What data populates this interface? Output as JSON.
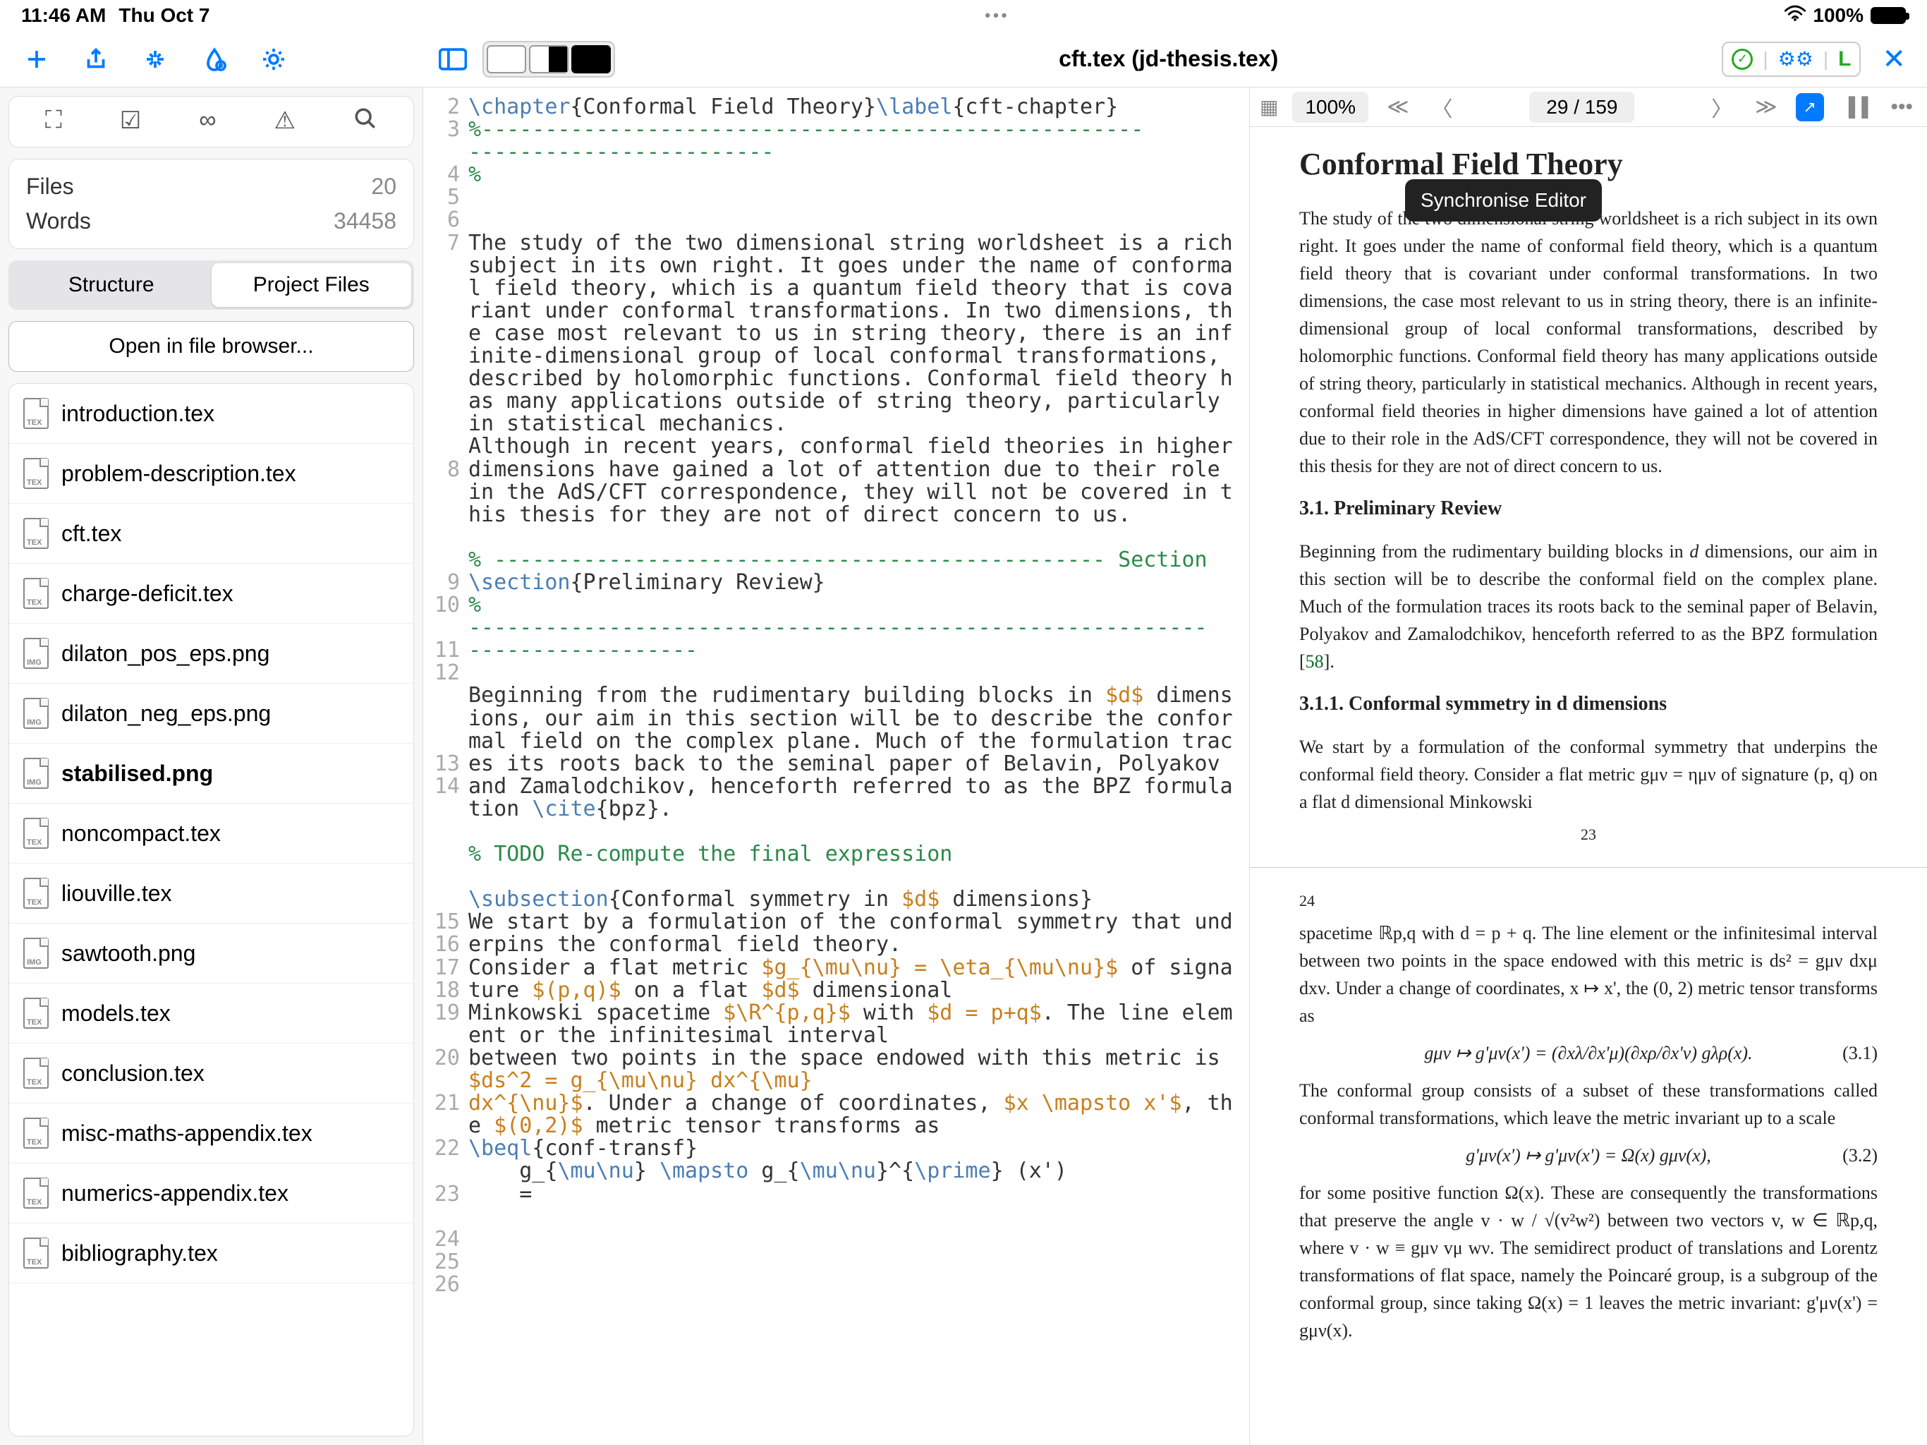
{
  "status_bar": {
    "time": "11:46 AM",
    "date": "Thu Oct 7",
    "wifi": "wifi-icon",
    "battery_pct": "100%"
  },
  "toolbar": {
    "title": "cft.tex (jd-thesis.tex)",
    "status_letter": "L"
  },
  "sidebar": {
    "stats": {
      "files_label": "Files",
      "files_value": "20",
      "words_label": "Words",
      "words_value": "34458"
    },
    "segments": {
      "structure": "Structure",
      "project": "Project Files"
    },
    "open_browser": "Open in file browser...",
    "files": [
      {
        "name": "introduction.tex",
        "ext": "TEX",
        "icon": "tex",
        "bold": false
      },
      {
        "name": "problem-description.tex",
        "ext": "TEX",
        "icon": "tex",
        "bold": false
      },
      {
        "name": "cft.tex",
        "ext": "TEX",
        "icon": "tex",
        "bold": false
      },
      {
        "name": "charge-deficit.tex",
        "ext": "TEX",
        "icon": "tex",
        "bold": false
      },
      {
        "name": "dilaton_pos_eps.png",
        "ext": "IMG",
        "icon": "img",
        "bold": false
      },
      {
        "name": "dilaton_neg_eps.png",
        "ext": "IMG",
        "icon": "img",
        "bold": false
      },
      {
        "name": "stabilised.png",
        "ext": "IMG",
        "icon": "img",
        "bold": true
      },
      {
        "name": "noncompact.tex",
        "ext": "TEX",
        "icon": "tex",
        "bold": false
      },
      {
        "name": "liouville.tex",
        "ext": "TEX",
        "icon": "tex",
        "bold": false
      },
      {
        "name": "sawtooth.png",
        "ext": "IMG",
        "icon": "img",
        "bold": false
      },
      {
        "name": "models.tex",
        "ext": "TEX",
        "icon": "tex",
        "bold": false
      },
      {
        "name": "conclusion.tex",
        "ext": "TEX",
        "icon": "tex",
        "bold": false
      },
      {
        "name": "misc-maths-appendix.tex",
        "ext": "TEX",
        "icon": "tex",
        "bold": false
      },
      {
        "name": "numerics-appendix.tex",
        "ext": "TEX",
        "icon": "tex",
        "bold": false
      },
      {
        "name": "bibliography.tex",
        "ext": "TEX",
        "icon": "tex",
        "bold": false
      }
    ]
  },
  "editor": {
    "lines": [
      {
        "n": 2,
        "segs": [
          {
            "t": "\\chapter",
            "c": "kw"
          },
          {
            "t": "{Conformal Field Theory}"
          },
          {
            "t": "\\label",
            "c": "kw"
          },
          {
            "t": "{cft-chapter}"
          }
        ]
      },
      {
        "n": 3,
        "segs": [
          {
            "t": "%----------------------------------------------------",
            "c": "cm"
          }
        ]
      },
      {
        "n": "",
        "segs": [
          {
            "t": "------------------------",
            "c": "cm"
          }
        ]
      },
      {
        "n": 4,
        "segs": [
          {
            "t": "%",
            "c": "cm"
          }
        ]
      },
      {
        "n": 5,
        "segs": [
          {
            "t": ""
          }
        ]
      },
      {
        "n": 6,
        "segs": [
          {
            "t": ""
          }
        ]
      },
      {
        "n": 7,
        "segs": [
          {
            "t": "The study of the two dimensional string worldsheet is a rich subject in its own right. It goes under the name of conformal field theory, which is a quantum field theory that is covariant under conformal transformations. In two dimensions, the case most relevant to us in string theory, there is an infinite-dimensional group of local conformal transformations, described by holomorphic functions. Conformal field theory has many applications outside of string theory, particularly in statistical mechanics."
          }
        ]
      },
      {
        "n": 8,
        "segs": [
          {
            "t": "Although in recent years, conformal field theories in higher dimensions have gained a lot of attention due to their role in the AdS/CFT correspondence, they will not be covered in this thesis for they are not of direct concern to us."
          }
        ]
      },
      {
        "n": 9,
        "segs": [
          {
            "t": ""
          }
        ]
      },
      {
        "n": 10,
        "segs": [
          {
            "t": "% ------------------------------------------------ Section",
            "c": "cm"
          }
        ]
      },
      {
        "n": 11,
        "segs": [
          {
            "t": "\\section",
            "c": "kw"
          },
          {
            "t": "{Preliminary Review}"
          }
        ]
      },
      {
        "n": 12,
        "segs": [
          {
            "t": "%",
            "c": "cm"
          }
        ]
      },
      {
        "n": "",
        "segs": [
          {
            "t": "----------------------------------------------------------",
            "c": "cm"
          }
        ]
      },
      {
        "n": "",
        "segs": [
          {
            "t": "------------------",
            "c": "cm"
          }
        ]
      },
      {
        "n": 13,
        "segs": [
          {
            "t": ""
          }
        ]
      },
      {
        "n": 14,
        "segs": [
          {
            "t": "Beginning from the rudimentary building blocks in "
          },
          {
            "t": "$d$",
            "c": "math"
          },
          {
            "t": " dimensions, our aim in this section will be to describe the conformal field on the complex plane. Much of the formulation traces its roots back to the seminal paper of Belavin, Polyakov and Zamalodchikov, henceforth referred to as the BPZ formulation "
          },
          {
            "t": "\\cite",
            "c": "kw"
          },
          {
            "t": "{bpz}."
          }
        ]
      },
      {
        "n": 15,
        "segs": [
          {
            "t": ""
          }
        ]
      },
      {
        "n": 16,
        "segs": [
          {
            "t": "% TODO Re-compute the final expression",
            "c": "cm"
          }
        ]
      },
      {
        "n": 17,
        "segs": [
          {
            "t": ""
          }
        ]
      },
      {
        "n": 18,
        "segs": [
          {
            "t": "\\subsection",
            "c": "kw"
          },
          {
            "t": "{Conformal symmetry in "
          },
          {
            "t": "$d$",
            "c": "math"
          },
          {
            "t": " dimensions}"
          }
        ]
      },
      {
        "n": 19,
        "segs": [
          {
            "t": "We start by a formulation of the conformal symmetry that underpins the conformal field theory."
          }
        ]
      },
      {
        "n": 20,
        "segs": [
          {
            "t": "Consider a flat metric "
          },
          {
            "t": "$g_{\\mu\\nu} = \\eta_{\\mu\\nu}$",
            "c": "math"
          },
          {
            "t": " of signature "
          },
          {
            "t": "$(p,q)$",
            "c": "math"
          },
          {
            "t": " on a flat "
          },
          {
            "t": "$d$",
            "c": "math"
          },
          {
            "t": " dimensional"
          }
        ]
      },
      {
        "n": 21,
        "segs": [
          {
            "t": "Minkowski spacetime "
          },
          {
            "t": "$\\R^{p,q}$",
            "c": "math"
          },
          {
            "t": " with "
          },
          {
            "t": "$d = p+q$",
            "c": "math"
          },
          {
            "t": ". The line element or the infinitesimal interval"
          }
        ]
      },
      {
        "n": 22,
        "segs": [
          {
            "t": "between two points in the space endowed with this metric is "
          },
          {
            "t": "$ds^2 = g_{\\mu\\nu} dx^{\\mu}",
            "c": "math"
          }
        ]
      },
      {
        "n": 23,
        "segs": [
          {
            "t": "dx^{\\nu}$",
            "c": "math"
          },
          {
            "t": ". Under a change of coordinates, "
          },
          {
            "t": "$x \\mapsto x'$",
            "c": "math"
          },
          {
            "t": ", the "
          },
          {
            "t": "$(0,2)$",
            "c": "math"
          },
          {
            "t": " metric tensor transforms as"
          }
        ]
      },
      {
        "n": 24,
        "segs": [
          {
            "t": "\\beql",
            "c": "kw"
          },
          {
            "t": "{conf-transf}"
          }
        ]
      },
      {
        "n": 25,
        "segs": [
          {
            "t": "    g_{"
          },
          {
            "t": "\\mu\\nu",
            "c": "kw"
          },
          {
            "t": "} "
          },
          {
            "t": "\\mapsto",
            "c": "kw"
          },
          {
            "t": " g_{"
          },
          {
            "t": "\\mu\\nu",
            "c": "kw"
          },
          {
            "t": "}^{"
          },
          {
            "t": "\\prime",
            "c": "kw"
          },
          {
            "t": "} (x')"
          }
        ]
      },
      {
        "n": 26,
        "segs": [
          {
            "t": "    ="
          }
        ]
      }
    ]
  },
  "preview": {
    "zoom": "100%",
    "page_counter": "29 / 159",
    "tooltip": "Synchronise Editor",
    "chapter_title": "Conformal Field Theory",
    "p1": "The study of the two dimensional string worldsheet is a rich subject in its own right. It goes under the name of conformal field theory, which is a quantum field theory that is covariant under conformal transformations. In two dimensions, the case most relevant to us in string theory, there is an infinite-dimensional group of local conformal transformations, described by holomorphic functions. Conformal field theory has many applications outside of string theory, particularly in statistical mechanics. Although in recent years, conformal field theories in higher dimensions have gained a lot of attention due to their role in the AdS/CFT correspondence, they will not be covered in this thesis for they are not of direct concern to us.",
    "h31": "3.1.  Preliminary Review",
    "p2a": "Beginning from the rudimentary building blocks in ",
    "p2b": " dimensions, our aim in this section will be to describe the conformal field on the complex plane. Much of the formulation traces its roots back to the seminal paper of Belavin, Polyakov and Zamalodchikov, henceforth referred to as the BPZ formulation [",
    "p2c": "].",
    "cite": "58",
    "h32": "3.1.1.  Conformal symmetry in d dimensions",
    "p3": "We start by a formulation of the conformal symmetry that underpins the conformal field theory. Consider a flat metric gμν = ημν of signature (p, q) on a flat d dimensional Minkowski",
    "pn1": "23",
    "pn2": "24",
    "p4": "spacetime ℝp,q with d = p + q. The line element or the infinitesimal interval between two points in the space endowed with this metric is ds² = gμν dxμ dxν. Under a change of coordinates, x ↦ x', the (0, 2) metric tensor transforms as",
    "eq1": "gμν ↦ g'μν(x') = (∂xλ/∂x'μ)(∂xρ/∂x'ν) gλρ(x).",
    "eq1n": "(3.1)",
    "p5": "The conformal group consists of a subset of these transformations called conformal transformations, which leave the metric invariant up to a scale",
    "eq2": "g'μν(x') ↦ g'μν(x') = Ω(x) gμν(x),",
    "eq2n": "(3.2)",
    "p6": "for some positive function Ω(x). These are consequently the transformations that preserve the angle v · w / √(v²w²) between two vectors v, w ∈ ℝp,q, where v · w ≡ gμν vμ wν. The semidirect product of translations and Lorentz transformations of flat space, namely the Poincaré group, is a subgroup of the conformal group, since taking Ω(x) = 1 leaves the metric invariant: g'μν(x') = gμν(x)."
  }
}
